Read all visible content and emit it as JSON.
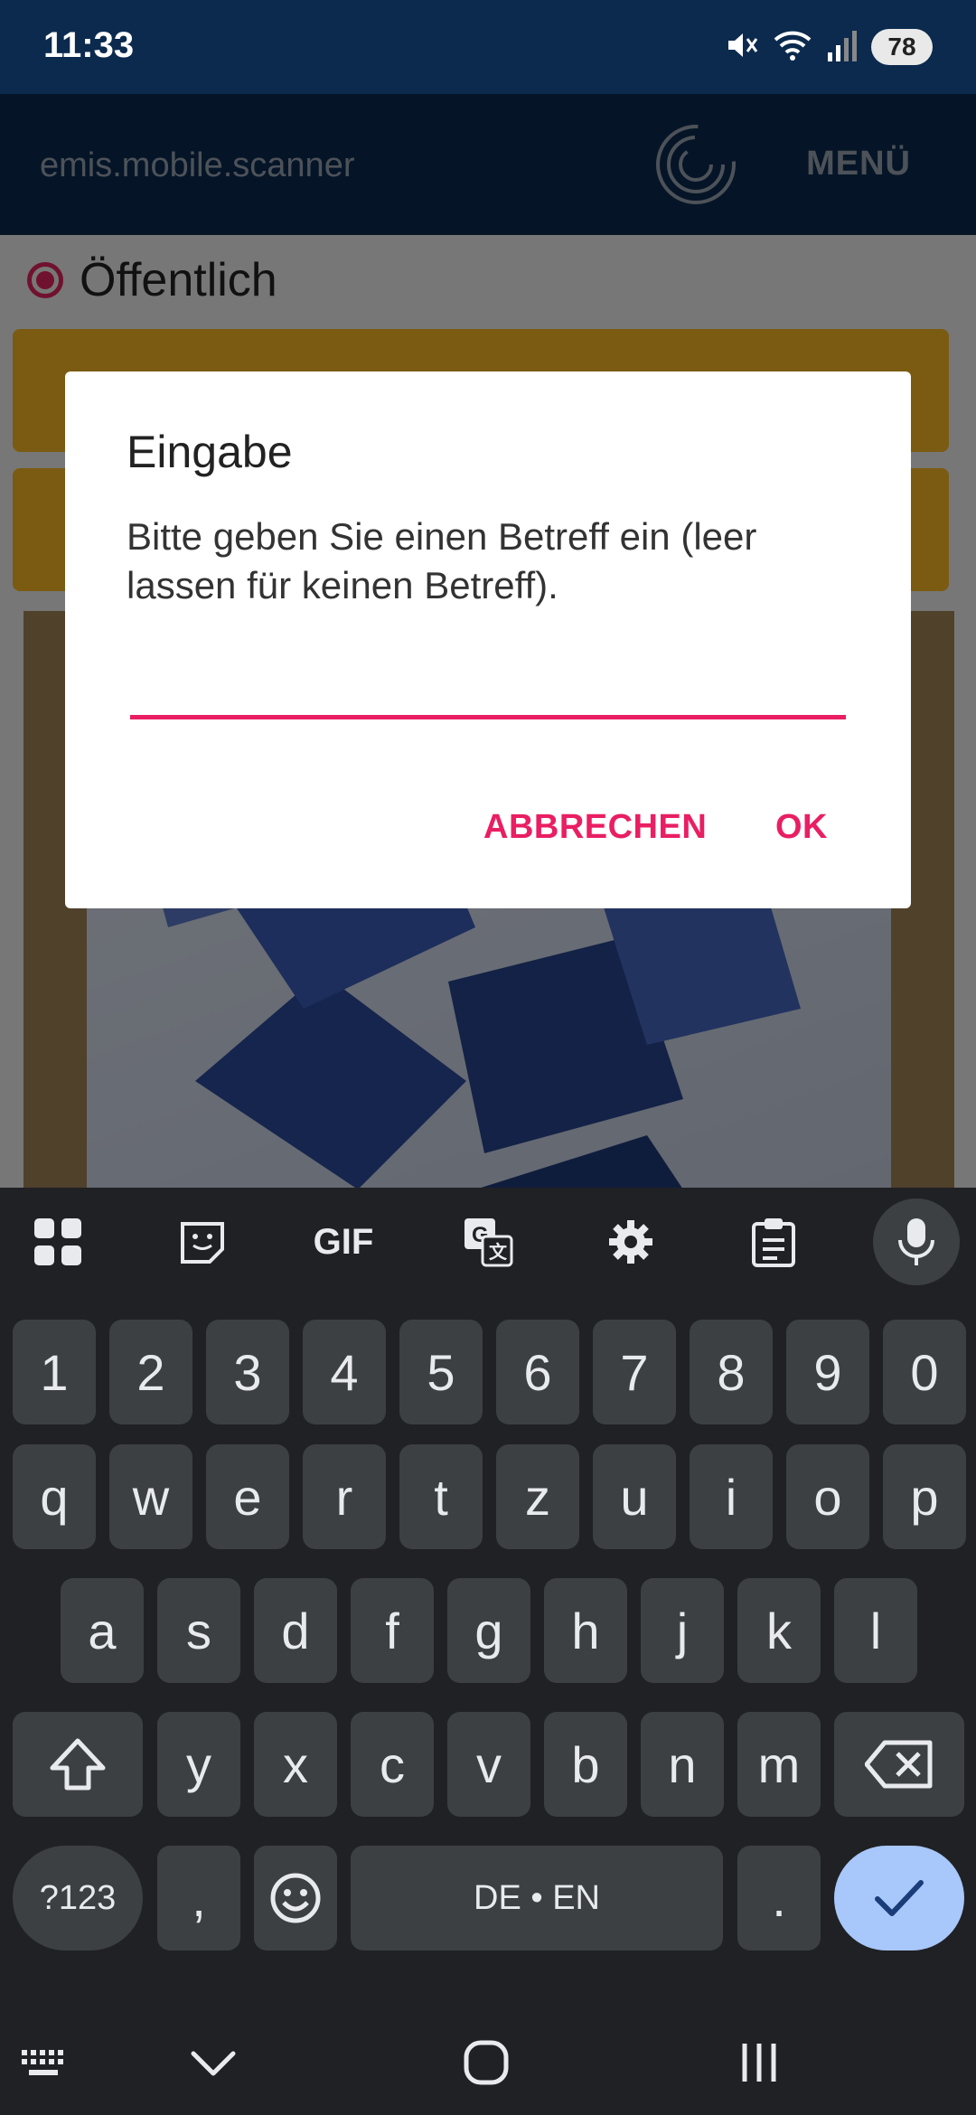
{
  "status_bar": {
    "time": "11:33",
    "battery": "78",
    "icons": [
      "mute-icon",
      "wifi-icon",
      "signal-icon",
      "battery-icon"
    ]
  },
  "app_bar": {
    "title": "emis.mobile.scanner",
    "menu_label": "MENÜ"
  },
  "content": {
    "radio_label": "Öffentlich",
    "accent_color": "#e0245e",
    "button_color": "#f5b622"
  },
  "dialog": {
    "title": "Eingabe",
    "message": "Bitte geben Sie einen Betreff ein (leer lassen für keinen Betreff).",
    "input_value": "",
    "cancel_label": "ABBRECHEN",
    "ok_label": "OK",
    "accent_color": "#e91e63"
  },
  "keyboard": {
    "toolbar": {
      "gif_label": "GIF",
      "icons": [
        "apps-grid-icon",
        "sticker-icon",
        "gif-icon",
        "translate-icon",
        "settings-gear-icon",
        "clipboard-icon",
        "microphone-icon"
      ]
    },
    "rows": {
      "numbers": [
        "1",
        "2",
        "3",
        "4",
        "5",
        "6",
        "7",
        "8",
        "9",
        "0"
      ],
      "row1": [
        "q",
        "w",
        "e",
        "r",
        "t",
        "z",
        "u",
        "i",
        "o",
        "p"
      ],
      "row2": [
        "a",
        "s",
        "d",
        "f",
        "g",
        "h",
        "j",
        "k",
        "l"
      ],
      "row3": [
        "y",
        "x",
        "c",
        "v",
        "b",
        "n",
        "m"
      ],
      "bottom": {
        "symbols": "?123",
        "comma": ",",
        "space": "DE • EN",
        "period": "."
      }
    }
  },
  "nav_bar": {
    "icons": [
      "keyboard-switch-icon",
      "hide-keyboard-icon",
      "home-icon",
      "recent-apps-icon"
    ]
  }
}
